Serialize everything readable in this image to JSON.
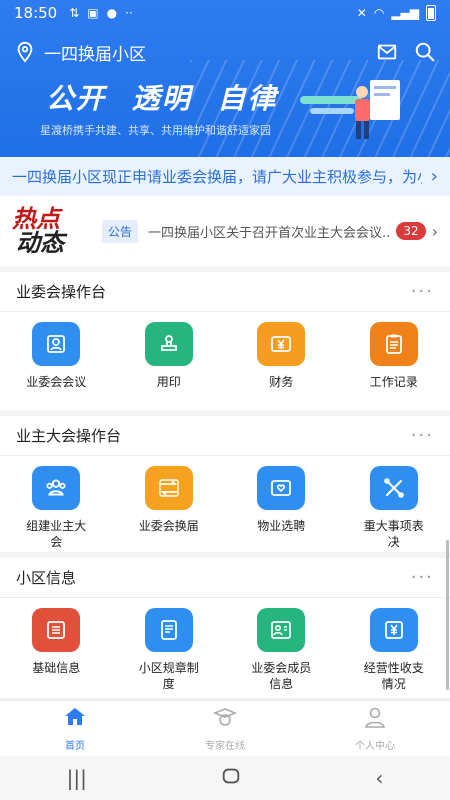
{
  "status": {
    "time": "18:50"
  },
  "header": {
    "community": "一四换届小区",
    "slogan": [
      "公开",
      "透明",
      "自律"
    ],
    "subslogan": "星渡桥携手共建、共享、共用维护和谐舒适家园"
  },
  "notice": {
    "text": "一四换届小区现正申请业委会换届，请广大业主积极参与，为小.."
  },
  "hot": {
    "logo_line1": "热点",
    "logo_line2": "动态",
    "tag": "公告",
    "text": "一四换届小区关于召开首次业主大会会议...",
    "count": "32"
  },
  "sections": [
    {
      "title": "业委会操作台",
      "items": [
        {
          "label": "业委会会议",
          "icon": "meeting-icon",
          "color": "#2f8ff1"
        },
        {
          "label": "用印",
          "icon": "seal-icon",
          "color": "#26b57f"
        },
        {
          "label": "财务",
          "icon": "finance-icon",
          "color": "#f59c21"
        },
        {
          "label": "工作记录",
          "icon": "clipboard-icon",
          "color": "#f08118"
        }
      ]
    },
    {
      "title": "业主大会操作台",
      "items": [
        {
          "label": "组建业主大会",
          "icon": "group-icon",
          "color": "#2f8ff1"
        },
        {
          "label": "业委会换届",
          "icon": "swap-icon",
          "color": "#f4a21f"
        },
        {
          "label": "物业选聘",
          "icon": "mail-heart-icon",
          "color": "#2f8ff1"
        },
        {
          "label": "重大事项表决",
          "icon": "tools-icon",
          "color": "#2f8ff1"
        }
      ]
    },
    {
      "title": "小区信息",
      "items": [
        {
          "label": "基础信息",
          "icon": "document-icon",
          "color": "#e0503b"
        },
        {
          "label": "小区规章制度",
          "icon": "rules-icon",
          "color": "#2f8ff1"
        },
        {
          "label": "业委会成员信息",
          "icon": "member-card-icon",
          "color": "#26b57f"
        },
        {
          "label": "经营性收支情况",
          "icon": "income-icon",
          "color": "#2f8ff1"
        }
      ]
    }
  ],
  "nav": [
    {
      "label": "首页",
      "icon": "home-icon",
      "active": true
    },
    {
      "label": "专家在线",
      "icon": "expert-icon",
      "active": false
    },
    {
      "label": "个人中心",
      "icon": "user-icon",
      "active": false
    }
  ],
  "colors": {
    "brand": "#2f7cf0",
    "badge": "#d93a3a"
  }
}
